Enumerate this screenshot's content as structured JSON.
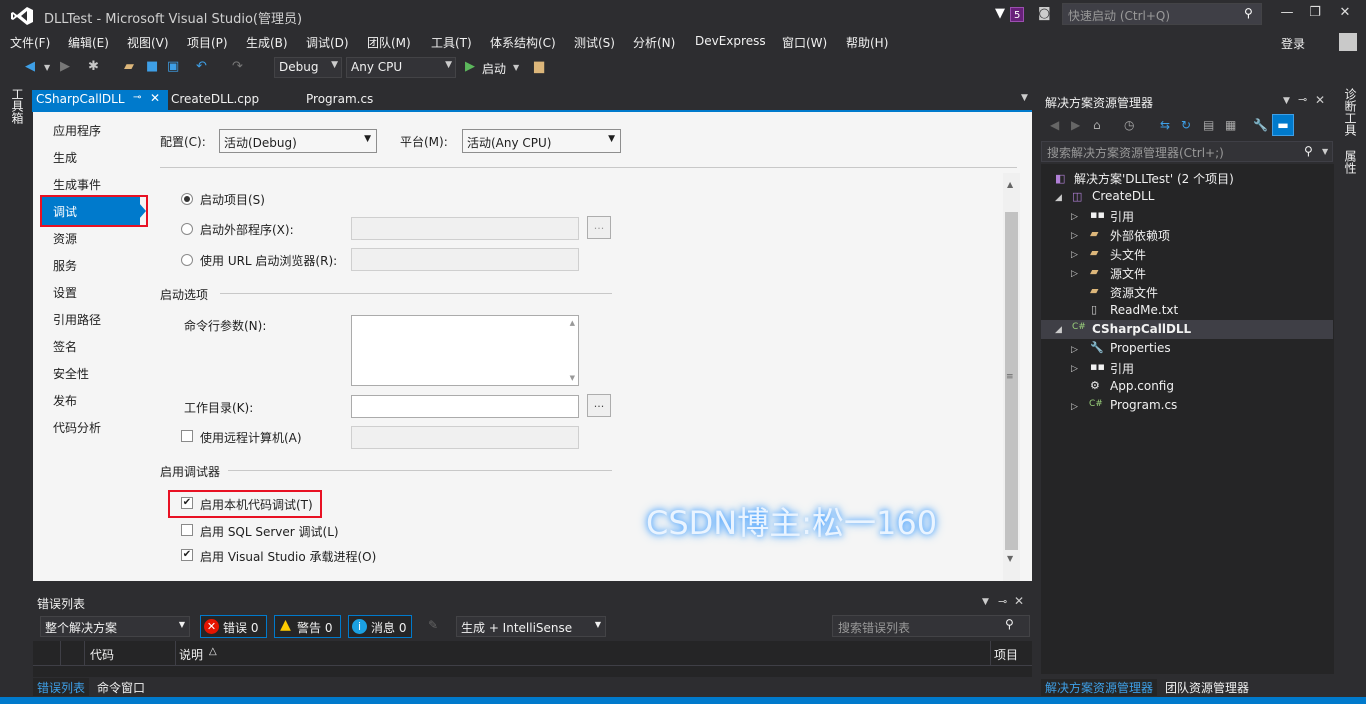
{
  "titlebar": {
    "title": "DLLTest - Microsoft Visual Studio(管理员)",
    "notification_count": "5",
    "quick_launch_placeholder": "快速启动 (Ctrl+Q)"
  },
  "menu": {
    "items": [
      "文件(F)",
      "编辑(E)",
      "视图(V)",
      "项目(P)",
      "生成(B)",
      "调试(D)",
      "团队(M)",
      "工具(T)",
      "体系结构(C)",
      "测试(S)",
      "分析(N)",
      "DevExpress",
      "窗口(W)",
      "帮助(H)"
    ],
    "login": "登录"
  },
  "toolbar": {
    "config": "Debug",
    "platform": "Any CPU",
    "start": "启动"
  },
  "left_strip": {
    "label": "工具箱"
  },
  "doc_tabs": [
    {
      "label": "CSharpCallDLL"
    },
    {
      "label": "CreateDLL.cpp"
    },
    {
      "label": "Program.cs"
    }
  ],
  "prop_nav": {
    "items": [
      "应用程序",
      "生成",
      "生成事件",
      "调试",
      "资源",
      "服务",
      "设置",
      "引用路径",
      "签名",
      "安全性",
      "发布",
      "代码分析"
    ]
  },
  "prop_page": {
    "config_label": "配置(C):",
    "config_value": "活动(Debug)",
    "platform_label": "平台(M):",
    "platform_value": "活动(Any CPU)",
    "start_project": "启动项目(S)",
    "start_external": "启动外部程序(X):",
    "start_url": "使用 URL 启动浏览器(R):",
    "start_options_header": "启动选项",
    "cmd_args": "命令行参数(N):",
    "work_dir": "工作目录(K):",
    "use_remote": "使用远程计算机(A)",
    "debuggers_header": "启用调试器",
    "native_debug": "启用本机代码调试(T)",
    "sql_debug": "启用 SQL Server 调试(L)",
    "vshost": "启用 Visual Studio 承载进程(O)",
    "browse": "...",
    "watermark": "CSDN博主:松一160"
  },
  "error_list": {
    "title": "错误列表",
    "scope": "整个解决方案",
    "errors": "错误 0",
    "warnings": "警告 0",
    "messages": "消息 0",
    "build_filter": "生成 + IntelliSense",
    "search_placeholder": "搜索错误列表",
    "col_code": "代码",
    "col_desc": "说明",
    "col_project": "项目"
  },
  "bottom_tabs": [
    "错误列表",
    "命令窗口"
  ],
  "solution_explorer": {
    "title": "解决方案资源管理器",
    "search_placeholder": "搜索解决方案资源管理器(Ctrl+;)",
    "nodes": [
      "解决方案'DLLTest' (2 个项目)",
      "CreateDLL",
      "引用",
      "外部依赖项",
      "头文件",
      "源文件",
      "资源文件",
      "ReadMe.txt",
      "CSharpCallDLL",
      "Properties",
      "引用",
      "App.config",
      "Program.cs"
    ],
    "tabs": [
      "解决方案资源管理器",
      "团队资源管理器"
    ]
  },
  "right_strip": {
    "label1": "诊断工具",
    "label2": "属性"
  },
  "colors": {
    "accent": "#007acc",
    "highlight_box": "#e81123"
  }
}
